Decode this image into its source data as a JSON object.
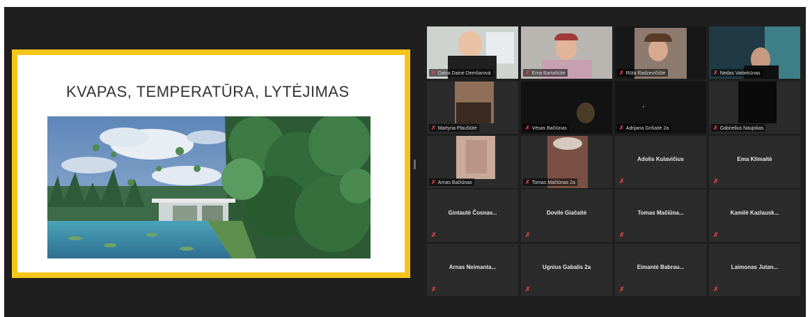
{
  "slide": {
    "title": "KVAPAS, TEMPERATŪRA, LYTĖJIMAS"
  },
  "colors": {
    "share_border": "#f5c518",
    "active_speaker": "#b5d334",
    "muted": "#e0443e",
    "background": "#1f1f1f",
    "tile": "#2b2b2b"
  },
  "icons": {
    "muted_mic": "✗"
  },
  "video_tiles": [
    {
      "name": "Daiva Dainė Demšarová",
      "active": true
    },
    {
      "name": "Ema Bartašiūtė",
      "active": false
    },
    {
      "name": "Rūta Radzevičiūtė",
      "active": false
    },
    {
      "name": "Nedas Vaitiekūnas",
      "active": false
    },
    {
      "name": "Martyna Plaušiūtė",
      "active": false
    },
    {
      "name": "Vėsas Bačiūnas",
      "active": false
    },
    {
      "name": "Adrijana Grišaitė 2a",
      "active": false
    },
    {
      "name": "Gabrielius Naujokas",
      "active": false
    },
    {
      "name": "Arnas Bačiūnas",
      "active": false
    },
    {
      "name": "Tomas Mačiūnas 2a",
      "active": false
    }
  ],
  "name_tiles": [
    {
      "name": "Adolis Kulavičius"
    },
    {
      "name": "Ema Klimaitė"
    },
    {
      "name": "Gintautė Čosnav..."
    },
    {
      "name": "Dovile Giačaitė"
    },
    {
      "name": "Tomas Mačiūna..."
    },
    {
      "name": "Kamilė Kazlausk..."
    },
    {
      "name": "Arnas Neimanta..."
    },
    {
      "name": "Ugnius Gabalis 2a"
    },
    {
      "name": "Eimantė Babrau..."
    },
    {
      "name": "Laimonas Jutan..."
    }
  ]
}
